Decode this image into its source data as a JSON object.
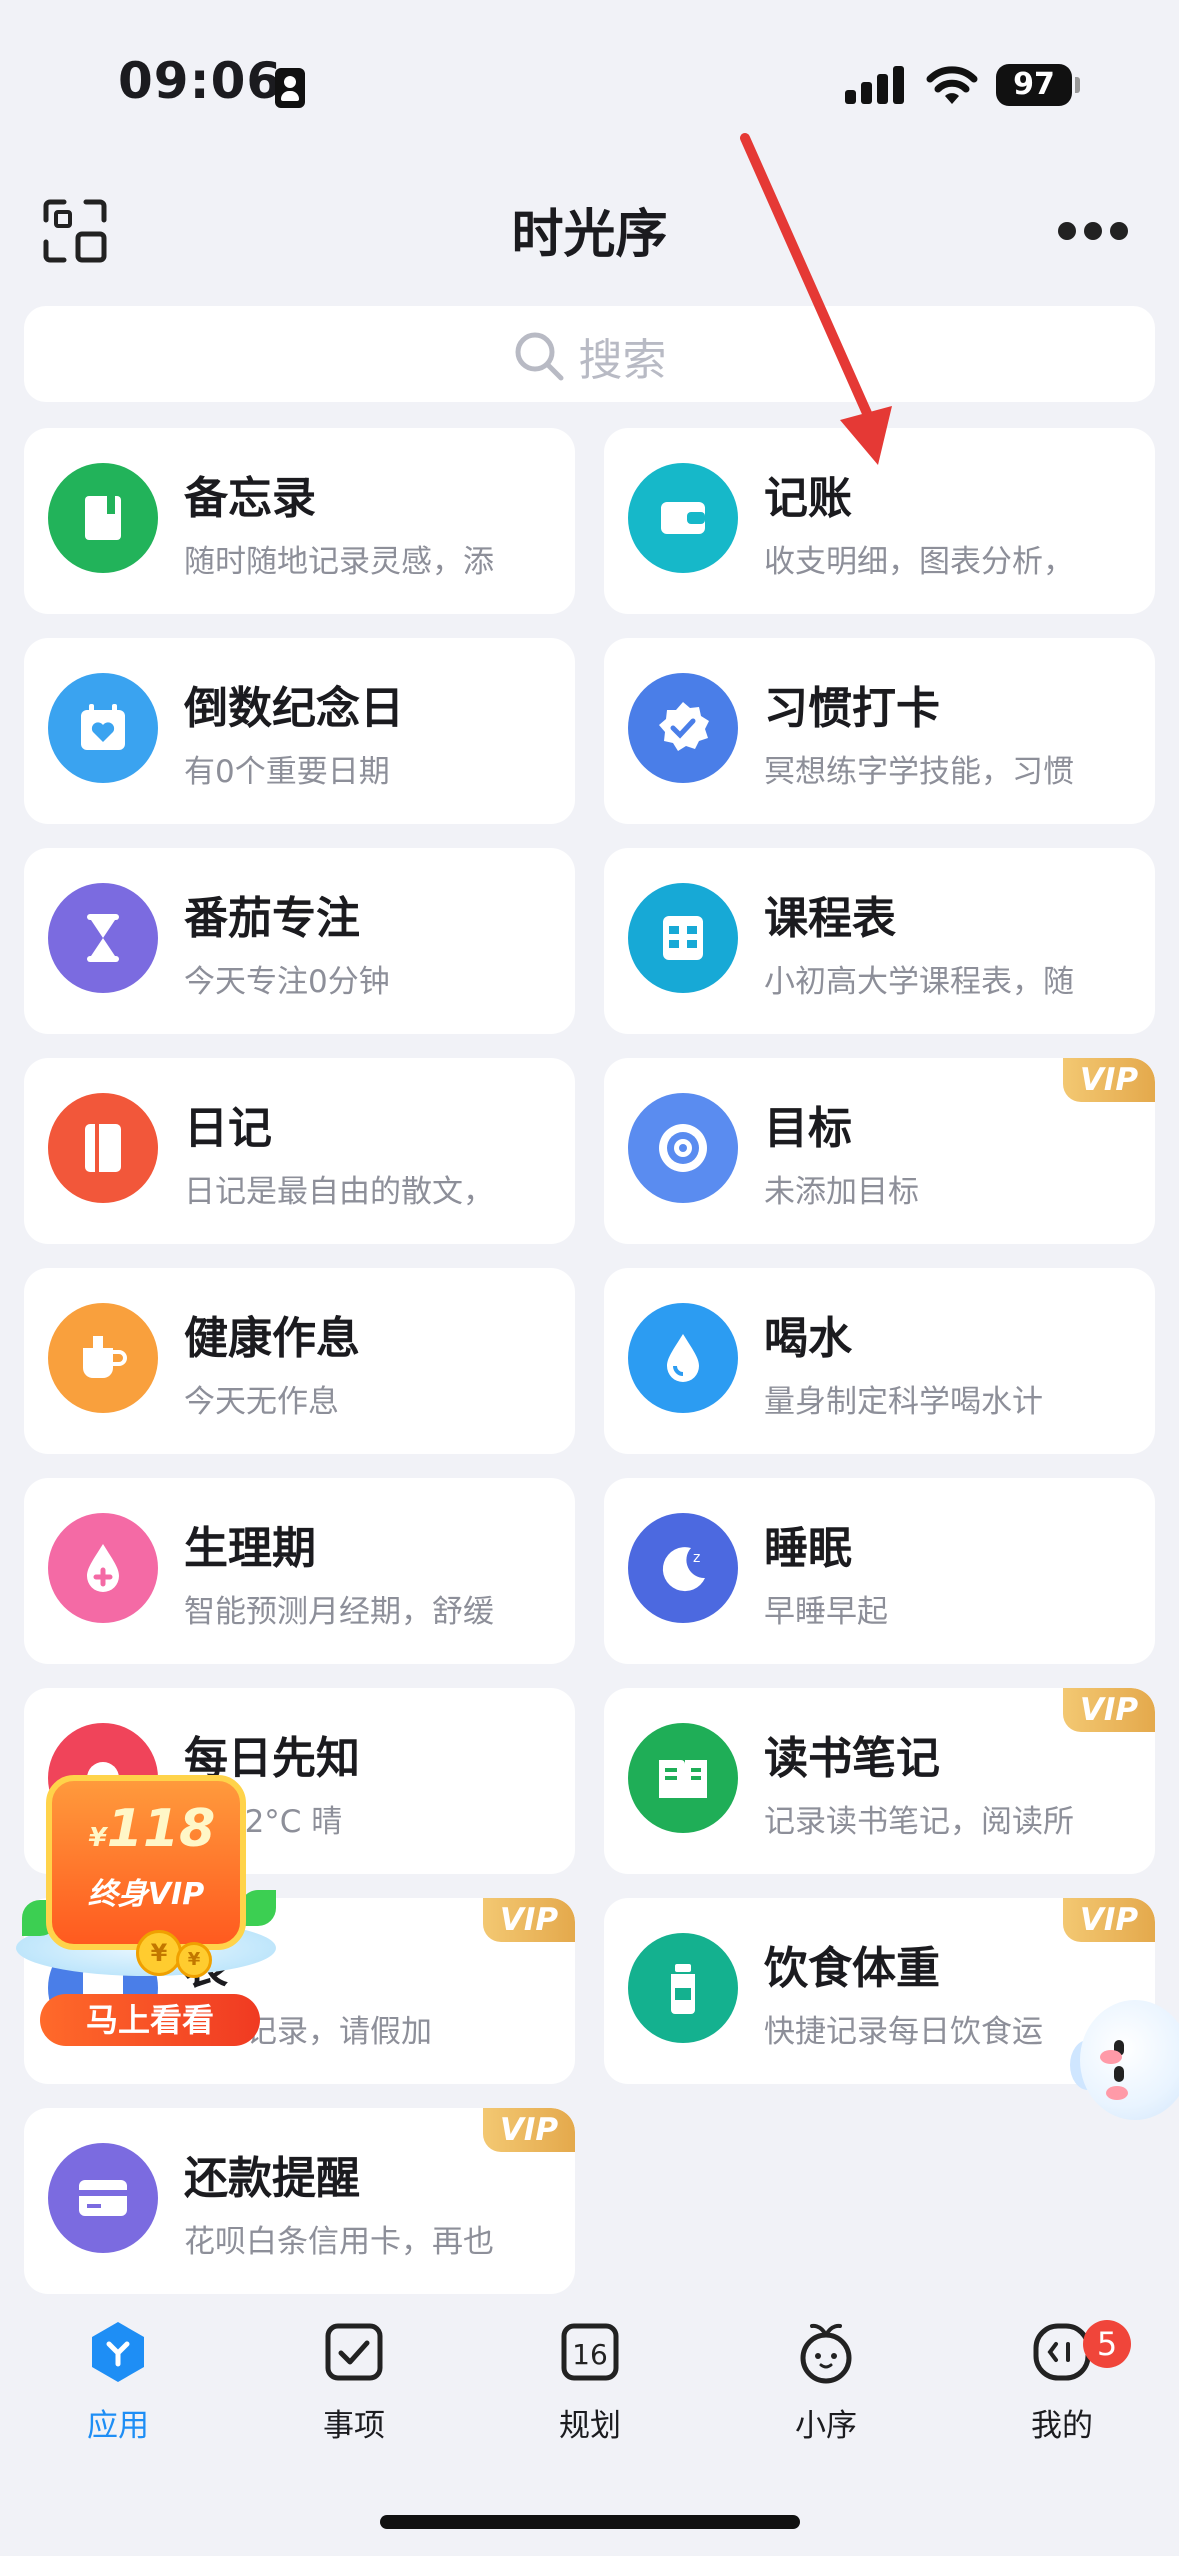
{
  "status_bar": {
    "time": "09:06",
    "battery": "97"
  },
  "header": {
    "title": "时光序"
  },
  "search": {
    "placeholder": "搜索"
  },
  "cards": [
    {
      "name": "备忘录",
      "desc": "随时随地记录灵感，添",
      "color": "#22b35a",
      "icon": "memo-icon"
    },
    {
      "name": "记账",
      "desc": "收支明细，图表分析，",
      "color": "#16b8c9",
      "icon": "wallet-icon"
    },
    {
      "name": "倒数纪念日",
      "desc": "有0个重要日期",
      "color": "#3aa3f0",
      "icon": "calendar-heart-icon"
    },
    {
      "name": "习惯打卡",
      "desc": "冥想练字学技能，习惯",
      "color": "#4a7ee8",
      "icon": "badge-check-icon"
    },
    {
      "name": "番茄专注",
      "desc": "今天专注0分钟",
      "color": "#7b6be0",
      "icon": "hourglass-icon"
    },
    {
      "name": "课程表",
      "desc": "小初高大学课程表，随",
      "color": "#17a9d6",
      "icon": "timetable-icon"
    },
    {
      "name": "日记",
      "desc": "日记是最自由的散文，",
      "color": "#f2573a",
      "icon": "diary-icon"
    },
    {
      "name": "目标",
      "desc": "未添加目标",
      "color": "#5a8cf0",
      "icon": "target-icon",
      "vip": "VIP"
    },
    {
      "name": "健康作息",
      "desc": "今天无作息",
      "color": "#f9a03d",
      "icon": "cup-icon"
    },
    {
      "name": "喝水",
      "desc": "量身制定科学喝水计",
      "color": "#2c9cf2",
      "icon": "water-drop-icon"
    },
    {
      "name": "生理期",
      "desc": "智能预测月经期，舒缓",
      "color": "#f46aa5",
      "icon": "drop-plus-icon"
    },
    {
      "name": "睡眠",
      "desc": "早睡早起",
      "color": "#4c69e0",
      "icon": "moon-icon"
    },
    {
      "name": "每日先知",
      "desc": "市 22°C 晴",
      "color": "#f0445a",
      "icon": "weather-icon"
    },
    {
      "name": "读书笔记",
      "desc": "记录读书笔记，阅读所",
      "color": "#1fae57",
      "icon": "book-icon",
      "vip": "VIP"
    },
    {
      "name": "表",
      "desc": "倒班记录，请假加",
      "color": "#4a7ee8",
      "icon": "shift-icon",
      "vip": "VIP"
    },
    {
      "name": "饮食体重",
      "desc": "快捷记录每日饮食运",
      "color": "#14b18f",
      "icon": "bottle-icon",
      "vip": "VIP"
    },
    {
      "name": "还款提醒",
      "desc": "花呗白条信用卡，再也",
      "color": "#7b6be0",
      "icon": "credit-card-icon",
      "vip": "VIP"
    }
  ],
  "promo": {
    "currency": "¥",
    "price": "118",
    "subtitle": "终身VIP",
    "button": "马上看看"
  },
  "tabs": [
    {
      "label": "应用",
      "icon": "apps-icon"
    },
    {
      "label": "事项",
      "icon": "checkbox-icon"
    },
    {
      "label": "规划",
      "icon": "calendar-16-icon",
      "icon_text": "16"
    },
    {
      "label": "小序",
      "icon": "mascot-icon"
    },
    {
      "label": "我的",
      "icon": "profile-icon",
      "badge": "5"
    }
  ],
  "colors": {
    "active_tab": "#1e8ef5",
    "arrow": "#e53935",
    "vip_gold": "#e4a94c"
  }
}
